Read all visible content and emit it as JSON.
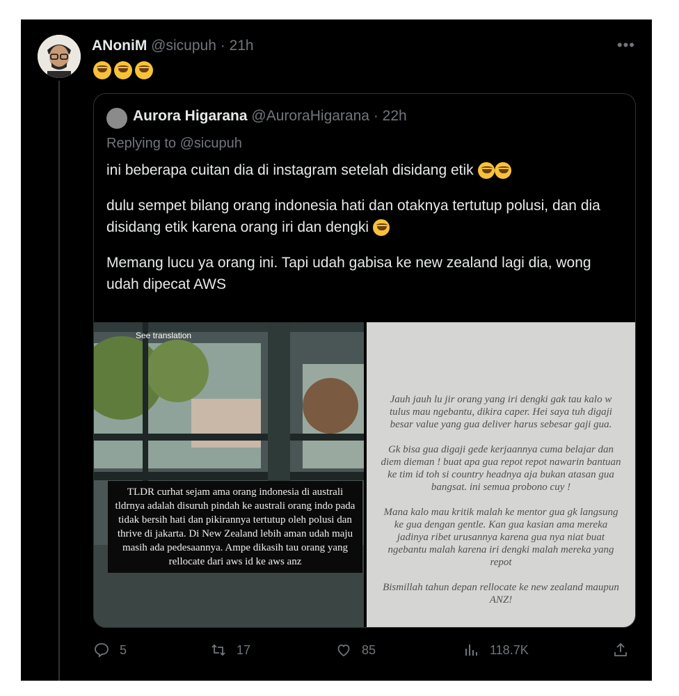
{
  "tweet": {
    "name": "ANoniM",
    "handle": "@sicupuh",
    "time": "21h",
    "emoji": [
      "rofl-emoji",
      "rofl-emoji",
      "rofl-emoji"
    ]
  },
  "quote": {
    "name": "Aurora Higarana",
    "handle": "@AuroraHigarana",
    "time": "22h",
    "replying": "Replying to @sicupuh",
    "para1": "ini beberapa cuitan dia di instagram setelah disidang etik",
    "para2": "dulu sempet bilang orang indonesia hati dan otaknya tertutup polusi, dan dia disidang etik karena orang iri dan dengki",
    "para3": "Memang lucu ya orang ini. Tapi udah gabisa ke new zealand lagi dia, wong udah dipecat AWS"
  },
  "media": {
    "left_caption_top": "See translation",
    "left_caption": "TLDR curhat sejam  ama orang indonesia di australi tldrnya adalah disuruh pindah ke australi orang indo pada tidak bersih hati dan pikirannya tertutup oleh polusi dan thrive di jakarta. Di New Zealand lebih aman udah maju masih ada pedesaannya. Ampe dikasih tau orang yang rellocate dari aws id ke aws anz",
    "right_p1": "Jauh jauh lu jir orang yang iri dengki gak tau kalo w tulus mau ngebantu, dikira caper. Hei saya tuh digaji besar value yang gua deliver harus sebesar gaji gua.",
    "right_p2": "Gk bisa gua digaji gede kerjaannya cuma belajar dan diem dieman ! buat apa gua repot repot nawarin bantuan ke tim id toh si country headnya aja bukan atasan gua bangsat. ini semua probono cuy !",
    "right_p3": "Mana kalo mau kritik malah ke mentor gua gk langsung ke gua dengan gentle. Kan gua kasian ama mereka jadinya ribet urusannya karena gua nya niat buat ngebantu malah karena iri dengki malah mereka yang repot",
    "right_p4": "Bismillah tahun depan rellocate ke new zealand maupun ANZ!"
  },
  "actions": {
    "replies": "5",
    "retweets": "17",
    "likes": "85",
    "views": "118.7K"
  },
  "colors": {
    "background": "#000000",
    "text": "#e7e9ea",
    "muted": "#71767b",
    "border": "#2f3336"
  }
}
